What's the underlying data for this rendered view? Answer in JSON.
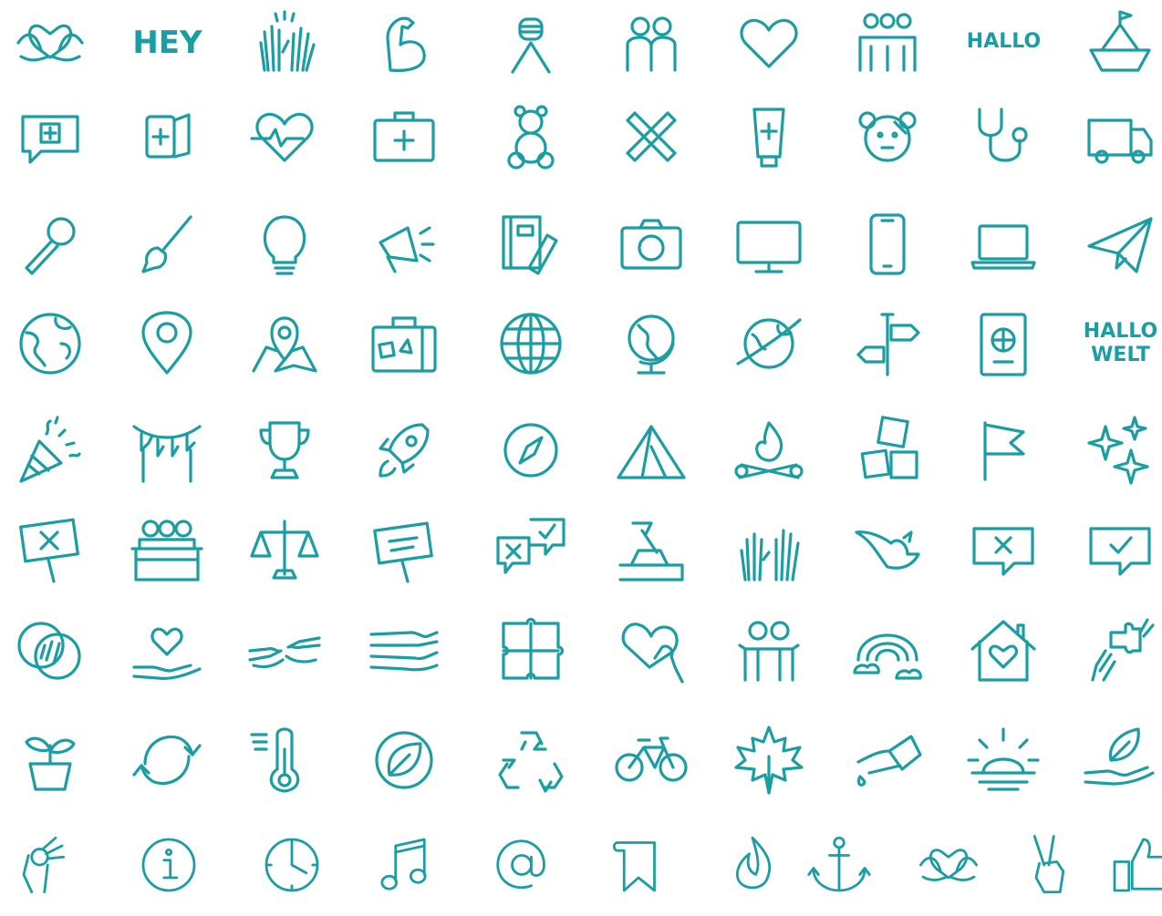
{
  "theme": {
    "icon_color": "#1a9ea3",
    "background": "#ffffff"
  },
  "icons": [
    {
      "name": "heart-hands-icon"
    },
    {
      "name": "hey-text-icon",
      "text": "HEY"
    },
    {
      "name": "high-five-icon"
    },
    {
      "name": "flexed-arm-icon"
    },
    {
      "name": "handshake-arm-icon"
    },
    {
      "name": "two-people-icon"
    },
    {
      "name": "heart-icon"
    },
    {
      "name": "group-hug-icon"
    },
    {
      "name": "hallo-text-icon",
      "text": "HALLO"
    },
    {
      "name": "paper-boat-icon"
    },
    {
      "name": "medical-chat-icon"
    },
    {
      "name": "bandage-roll-icon"
    },
    {
      "name": "heartbeat-icon"
    },
    {
      "name": "first-aid-kit-icon"
    },
    {
      "name": "teddy-bear-icon"
    },
    {
      "name": "crossed-plasters-icon"
    },
    {
      "name": "ointment-tube-icon"
    },
    {
      "name": "injured-teddy-icon"
    },
    {
      "name": "stethoscope-icon"
    },
    {
      "name": "ambulance-icon"
    },
    {
      "name": "microphone-icon"
    },
    {
      "name": "paintbrush-icon"
    },
    {
      "name": "lightbulb-icon"
    },
    {
      "name": "megaphone-icon"
    },
    {
      "name": "notebook-pencil-icon"
    },
    {
      "name": "camera-icon"
    },
    {
      "name": "monitor-icon"
    },
    {
      "name": "smartphone-icon"
    },
    {
      "name": "laptop-icon"
    },
    {
      "name": "paper-plane-icon"
    },
    {
      "name": "earth-icon"
    },
    {
      "name": "location-pin-icon"
    },
    {
      "name": "map-pin-icon"
    },
    {
      "name": "suitcase-icon"
    },
    {
      "name": "globe-grid-icon"
    },
    {
      "name": "desk-globe-icon"
    },
    {
      "name": "orbit-globe-icon"
    },
    {
      "name": "signpost-icon"
    },
    {
      "name": "passport-icon"
    },
    {
      "name": "hallo-welt-text-icon",
      "text": "HALLO WELT"
    },
    {
      "name": "party-popper-icon"
    },
    {
      "name": "bunting-icon"
    },
    {
      "name": "trophy-icon"
    },
    {
      "name": "rocket-icon"
    },
    {
      "name": "compass-icon"
    },
    {
      "name": "tent-icon"
    },
    {
      "name": "campfire-icon"
    },
    {
      "name": "abc-blocks-icon"
    },
    {
      "name": "flag-icon"
    },
    {
      "name": "sparkles-icon"
    },
    {
      "name": "protest-sign-x-icon"
    },
    {
      "name": "audience-icon"
    },
    {
      "name": "scales-icon"
    },
    {
      "name": "protest-sign-icon"
    },
    {
      "name": "vote-chat-icon"
    },
    {
      "name": "ballot-box-icon"
    },
    {
      "name": "raised-hands-icon"
    },
    {
      "name": "dove-icon"
    },
    {
      "name": "chat-x-icon"
    },
    {
      "name": "chat-check-icon"
    },
    {
      "name": "overlapping-circles-icon"
    },
    {
      "name": "hand-heart-icon"
    },
    {
      "name": "reaching-hands-icon"
    },
    {
      "name": "stacked-hands-icon"
    },
    {
      "name": "puzzle-icon"
    },
    {
      "name": "hand-holding-heart-icon"
    },
    {
      "name": "embrace-icon"
    },
    {
      "name": "rainbow-icon"
    },
    {
      "name": "home-heart-icon"
    },
    {
      "name": "puzzle-hands-icon"
    },
    {
      "name": "sprout-pot-icon"
    },
    {
      "name": "cycle-arrows-icon"
    },
    {
      "name": "thermometer-icon"
    },
    {
      "name": "leaf-circle-icon"
    },
    {
      "name": "recycle-icon"
    },
    {
      "name": "bicycle-icon"
    },
    {
      "name": "maple-leaf-icon"
    },
    {
      "name": "watering-can-icon"
    },
    {
      "name": "sunrise-icon"
    },
    {
      "name": "hand-leaf-icon"
    },
    {
      "name": "ok-hand-icon"
    },
    {
      "name": "info-icon"
    },
    {
      "name": "clock-icon"
    },
    {
      "name": "music-note-icon"
    },
    {
      "name": "at-sign-icon"
    },
    {
      "name": "bookmark-icon"
    },
    {
      "name": "flame-icon"
    },
    {
      "name": "anchor-icon"
    },
    {
      "name": "heart-hands-icon"
    },
    {
      "name": "peace-hand-icon"
    },
    {
      "name": "thumbs-up-icon"
    }
  ]
}
